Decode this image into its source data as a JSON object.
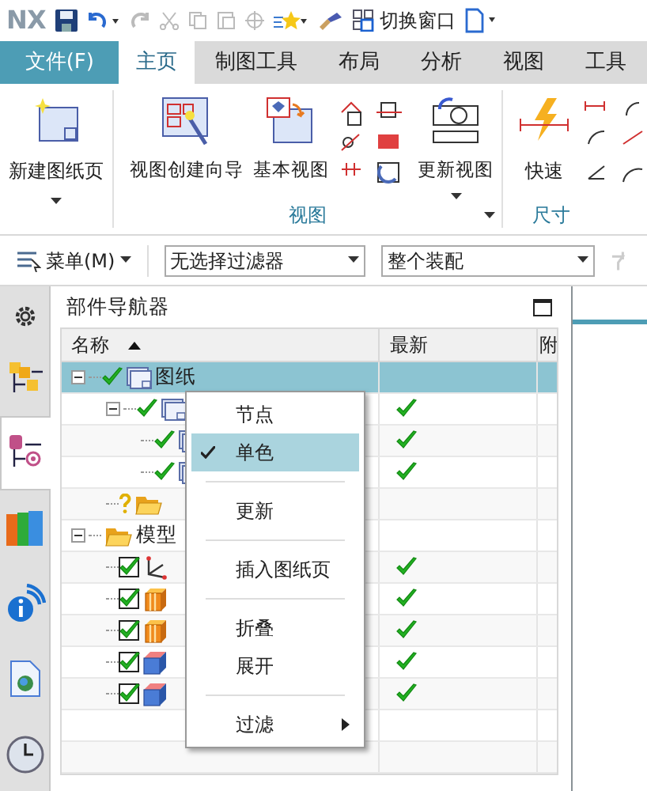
{
  "quick_access": {
    "logo": "NX",
    "switch_window": "切换窗口"
  },
  "tabs": [
    {
      "label": "文件(F)",
      "kind": "file",
      "selected": false
    },
    {
      "label": "主页",
      "kind": "tab",
      "selected": true
    },
    {
      "label": "制图工具",
      "kind": "tab",
      "selected": false
    },
    {
      "label": "布局",
      "kind": "tab",
      "selected": false
    },
    {
      "label": "分析",
      "kind": "tab",
      "selected": false
    },
    {
      "label": "视图",
      "kind": "tab",
      "selected": false
    },
    {
      "label": "工具",
      "kind": "tab",
      "selected": false
    }
  ],
  "ribbon": {
    "new_sheet": "新建图纸页",
    "view_wizard": "视图创建向导",
    "base_view": "基本视图",
    "update_view": "更新视图",
    "view_group": "视图",
    "quick": "快速",
    "dim_group": "尺寸"
  },
  "toolbar": {
    "menu": "菜单(M)",
    "filter": "无选择过滤器",
    "scope": "整个装配"
  },
  "side_tabs": [
    {
      "kind": "gear",
      "selected": false
    },
    {
      "kind": "assembly",
      "selected": false
    },
    {
      "kind": "constraint",
      "selected": true
    },
    {
      "kind": "books",
      "selected": false
    },
    {
      "kind": "info",
      "selected": false
    },
    {
      "kind": "web",
      "selected": false
    },
    {
      "kind": "clock",
      "selected": false
    }
  ],
  "navigator": {
    "title": "部件导航器",
    "columns": [
      "名称",
      "最新",
      "附"
    ],
    "rows": [
      {
        "name": "图纸",
        "kind": "sheet",
        "latest": false,
        "selected": true,
        "expanded": true,
        "children": [
          {
            "kind": "sheet",
            "latest": true,
            "selected": false,
            "expanded": true,
            "children": [
              {
                "kind": "sheet",
                "latest": true,
                "selected": false
              },
              {
                "kind": "sheet",
                "latest": true,
                "selected": false
              }
            ]
          },
          {
            "kind": "pending-folder",
            "latest": false,
            "selected": false
          }
        ]
      },
      {
        "name": "模型",
        "kind": "folder",
        "latest": false,
        "selected": false,
        "expanded": true,
        "children": [
          {
            "kind": "csys",
            "checked": true,
            "latest": true,
            "selected": false
          },
          {
            "kind": "extrude",
            "checked": true,
            "latest": true,
            "selected": false
          },
          {
            "kind": "extrude",
            "checked": true,
            "latest": true,
            "selected": false
          },
          {
            "kind": "block",
            "checked": true,
            "latest": true,
            "selected": false
          },
          {
            "kind": "block",
            "checked": true,
            "latest": true,
            "selected": false
          }
        ]
      }
    ]
  },
  "context_menu": [
    {
      "kind": "item",
      "label": "节点",
      "checked": false
    },
    {
      "kind": "item",
      "label": "单色",
      "checked": true
    },
    {
      "kind": "separator"
    },
    {
      "kind": "item",
      "label": "更新",
      "checked": false
    },
    {
      "kind": "separator"
    },
    {
      "kind": "item",
      "label": "插入图纸页",
      "checked": false
    },
    {
      "kind": "separator"
    },
    {
      "kind": "item",
      "label": "折叠",
      "checked": false
    },
    {
      "kind": "item",
      "label": "展开",
      "checked": false
    },
    {
      "kind": "separator"
    },
    {
      "kind": "submenu",
      "label": "过滤",
      "checked": false
    }
  ]
}
